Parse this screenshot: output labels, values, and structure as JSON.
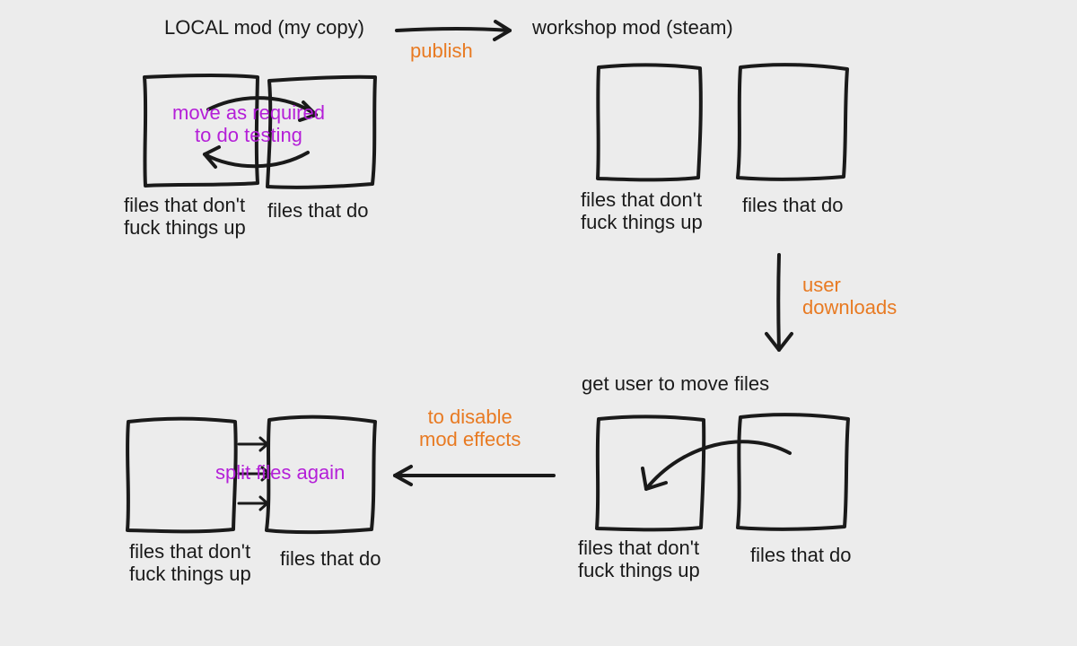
{
  "colors": {
    "bg": "#ececec",
    "ink": "#1a1a1a",
    "orange": "#e87a22",
    "purple": "#b41fd8"
  },
  "labels": {
    "local_title": "LOCAL mod (my copy)",
    "workshop_title": "workshop mod (steam)",
    "publish": "publish",
    "testing_note": "move as required\nto do testing",
    "files_safe": "files that don't\nfuck things up",
    "files_do": "files that do",
    "user_downloads": "user\ndownloads",
    "get_user_move": "get user to move files",
    "to_disable": "to disable\nmod effects",
    "split_again": "split files again"
  }
}
